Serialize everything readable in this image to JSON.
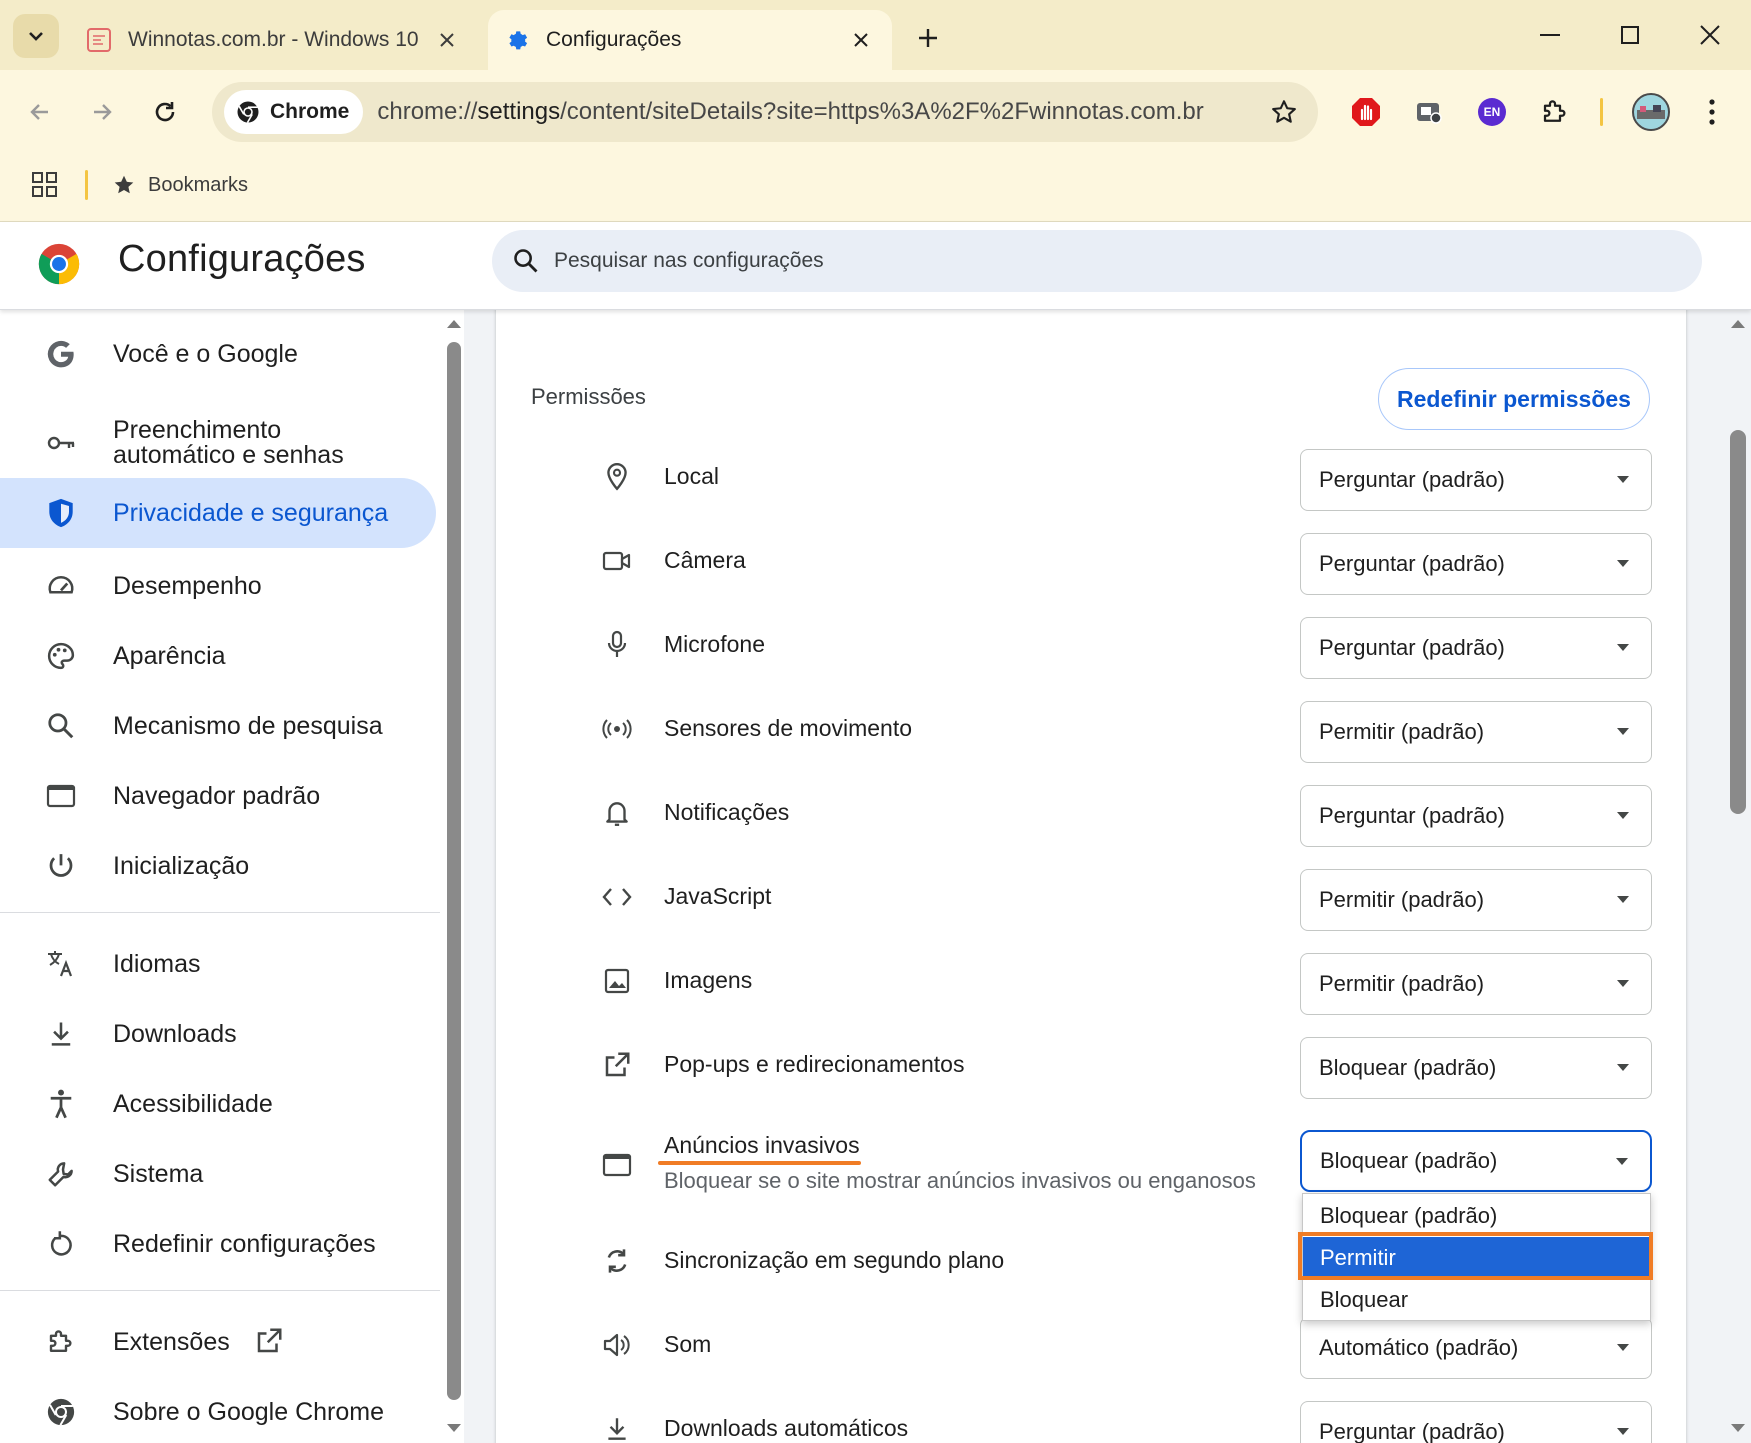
{
  "tabs": [
    {
      "title": "Winnotas.com.br - Windows 10",
      "active": false
    },
    {
      "title": "Configurações",
      "active": true
    }
  ],
  "toolbar": {
    "chip_label": "Chrome",
    "url_prefix": "chrome://",
    "url_host": "settings",
    "url_rest": "/content/siteDetails?site=https%3A%2F%2Fwinnotas.com.br",
    "lang_badge": "EN"
  },
  "bookmarks": {
    "label": "Bookmarks"
  },
  "header": {
    "title": "Configurações",
    "search_placeholder": "Pesquisar nas configurações"
  },
  "sidebar": {
    "items": [
      {
        "label": "Você e o Google",
        "icon": "google-icon"
      },
      {
        "label": "Preenchimento automático e senhas",
        "icon": "key-icon"
      },
      {
        "label": "Privacidade e segurança",
        "icon": "shield-icon",
        "active": true
      },
      {
        "label": "Desempenho",
        "icon": "gauge-icon"
      },
      {
        "label": "Aparência",
        "icon": "palette-icon"
      },
      {
        "label": "Mecanismo de pesquisa",
        "icon": "search-icon"
      },
      {
        "label": "Navegador padrão",
        "icon": "browser-window-icon"
      },
      {
        "label": "Inicialização",
        "icon": "power-icon"
      },
      {
        "label": "Idiomas",
        "icon": "translate-icon"
      },
      {
        "label": "Downloads",
        "icon": "download-icon"
      },
      {
        "label": "Acessibilidade",
        "icon": "accessibility-icon"
      },
      {
        "label": "Sistema",
        "icon": "wrench-icon"
      },
      {
        "label": "Redefinir configurações",
        "icon": "restore-icon"
      },
      {
        "label": "Extensões",
        "icon": "puzzle-icon"
      },
      {
        "label": "Sobre o Google Chrome",
        "icon": "chrome-icon"
      }
    ]
  },
  "permissions": {
    "section_title": "Permissões",
    "reset_label": "Redefinir permissões",
    "rows": [
      {
        "label": "Local",
        "value": "Perguntar (padrão)",
        "icon": "location-pin-icon"
      },
      {
        "label": "Câmera",
        "value": "Perguntar (padrão)",
        "icon": "camera-icon"
      },
      {
        "label": "Microfone",
        "value": "Perguntar (padrão)",
        "icon": "microphone-icon"
      },
      {
        "label": "Sensores de movimento",
        "value": "Permitir (padrão)",
        "icon": "sensors-icon"
      },
      {
        "label": "Notificações",
        "value": "Perguntar (padrão)",
        "icon": "bell-icon"
      },
      {
        "label": "JavaScript",
        "value": "Permitir (padrão)",
        "icon": "code-icon"
      },
      {
        "label": "Imagens",
        "value": "Permitir (padrão)",
        "icon": "image-icon"
      },
      {
        "label": "Pop-ups e redirecionamentos",
        "value": "Bloquear (padrão)",
        "icon": "open-in-new-icon"
      },
      {
        "label": "Anúncios invasivos",
        "sublabel": "Bloquear se o site mostrar anúncios invasivos ou enganosos",
        "value": "Bloquear (padrão)",
        "icon": "ads-window-icon"
      },
      {
        "label": "Sincronização em segundo plano",
        "value": "",
        "icon": "sync-icon"
      },
      {
        "label": "Som",
        "value": "Automático (padrão)",
        "icon": "speaker-icon"
      },
      {
        "label": "Downloads automáticos",
        "value": "Perguntar (padrão)",
        "icon": "download-icon"
      }
    ],
    "dropdown_options": [
      "Bloquear (padrão)",
      "Permitir",
      "Bloquear"
    ],
    "dropdown_selected": "Permitir"
  },
  "colors": {
    "accent": "#0b57d0",
    "active_nav_bg": "#d3e3fd",
    "highlight_orange": "#f07c25",
    "tabstrip": "#f4ecc9"
  }
}
